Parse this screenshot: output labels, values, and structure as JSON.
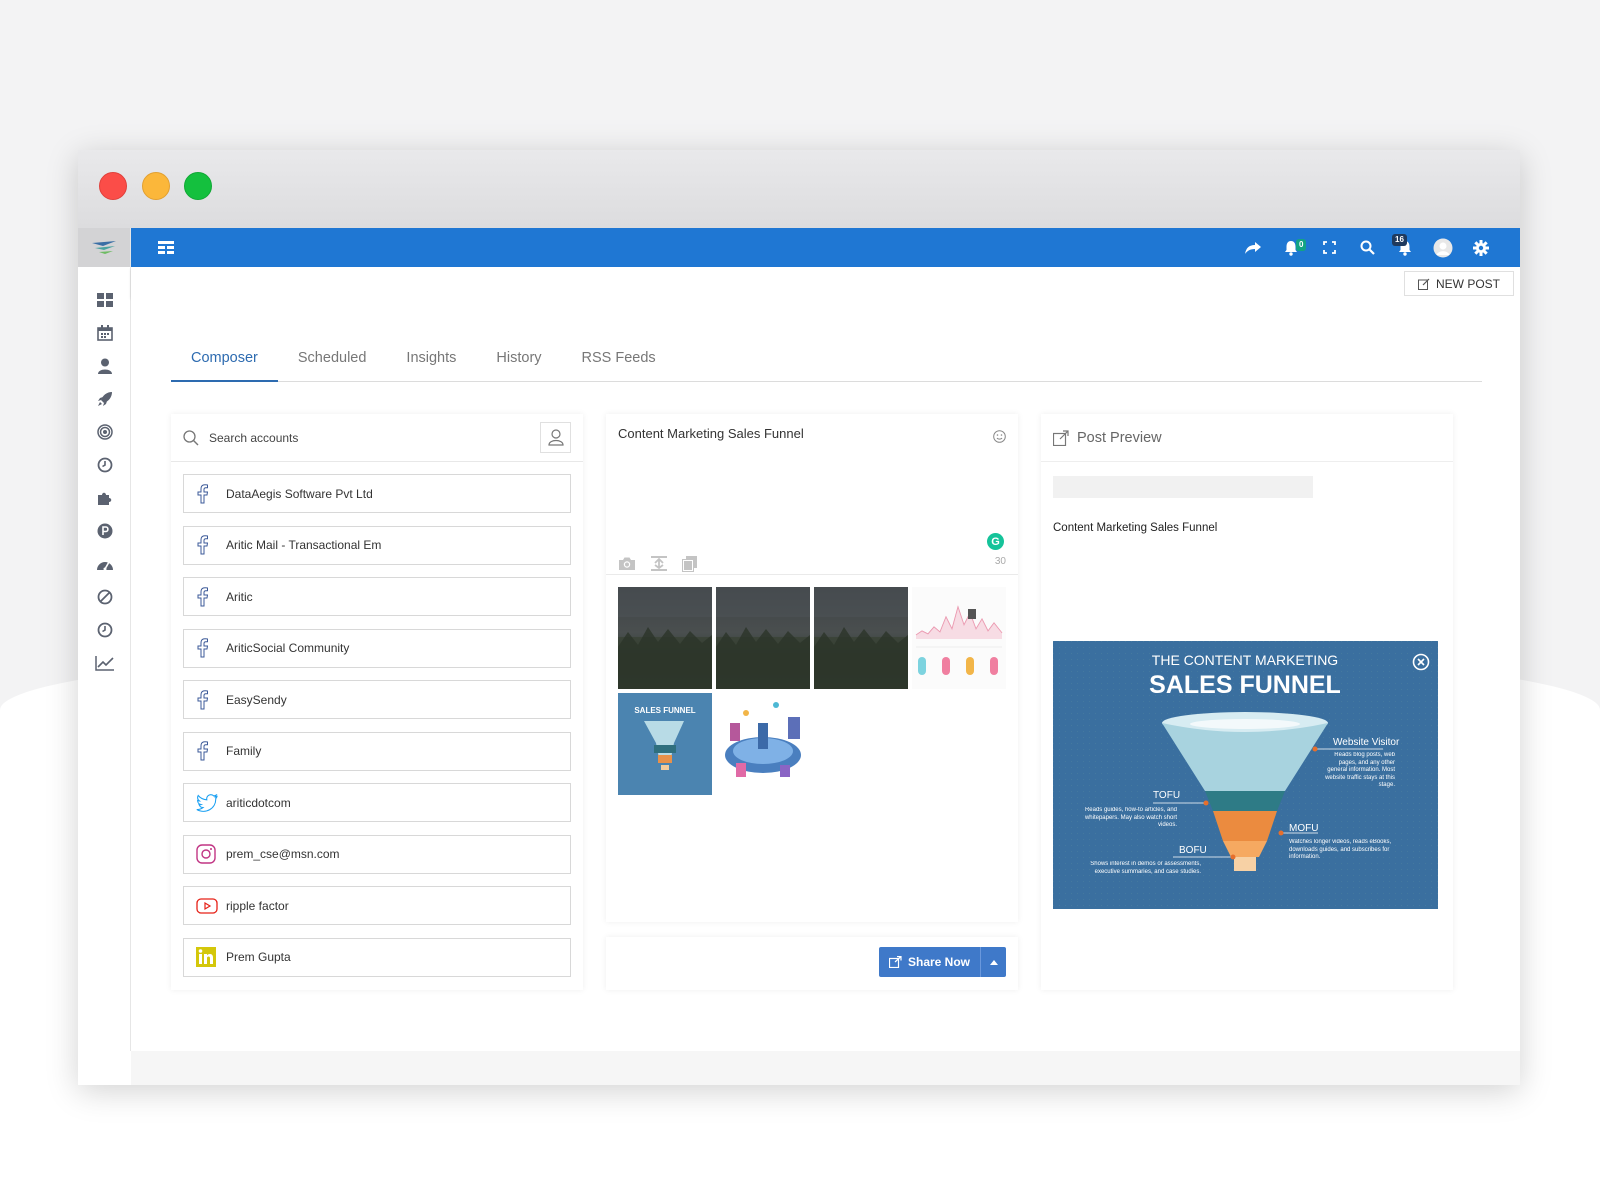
{
  "tabs": [
    {
      "label": "Composer"
    },
    {
      "label": "Scheduled"
    },
    {
      "label": "Insights"
    },
    {
      "label": "History"
    },
    {
      "label": "RSS Feeds"
    }
  ],
  "topbar": {
    "notifications_count": "0",
    "alerts_count": "16",
    "new_post_label": "NEW POST"
  },
  "accounts": {
    "search_placeholder": "Search accounts",
    "items": [
      {
        "name": "DataAegis Software Pvt Ltd",
        "network": "facebook"
      },
      {
        "name": "Aritic Mail - Transactional Em",
        "network": "facebook"
      },
      {
        "name": "Aritic",
        "network": "facebook"
      },
      {
        "name": "AriticSocial Community",
        "network": "facebook"
      },
      {
        "name": "EasySendy",
        "network": "facebook"
      },
      {
        "name": "Family",
        "network": "facebook"
      },
      {
        "name": "ariticdotcom",
        "network": "twitter"
      },
      {
        "name": "prem_cse@msn.com",
        "network": "instagram"
      },
      {
        "name": "ripple factor",
        "network": "youtube"
      },
      {
        "name": "Prem Gupta",
        "network": "linkedin"
      }
    ]
  },
  "composer": {
    "text": "Content Marketing Sales Funnel",
    "char_count": "30",
    "grammarly_letter": "G",
    "share_label": "Share Now"
  },
  "preview": {
    "title": "Post Preview",
    "text": "Content Marketing Sales Funnel",
    "image": {
      "heading_small": "THE CONTENT MARKETING",
      "heading_big": "SALES FUNNEL",
      "label_visitor": "Website Visitor",
      "text_visitor": "Reads blog posts, web pages, and any other general information. Most website traffic stays at this stage.",
      "label_tofu": "TOFU",
      "text_tofu": "Reads guides, how-to articles, and whitepapers. May also watch short videos.",
      "label_mofu": "MOFU",
      "text_mofu": "Watches longer videos, reads eBooks, downloads guides, and subscribes for information.",
      "label_bofu": "BOFU",
      "text_bofu": "Shows interest in demos or assessments, executive summaries, and case studies.",
      "thumb_title": "SALES FUNNEL"
    }
  },
  "colors": {
    "topbar": "#1f77d3",
    "accent": "#2d6bb0",
    "share_button": "#3f79c9",
    "facebook": "#3b5998",
    "twitter": "#1da1f2",
    "instagram": "#c13584",
    "youtube": "#e62117",
    "linkedin": "#d4c70a"
  }
}
